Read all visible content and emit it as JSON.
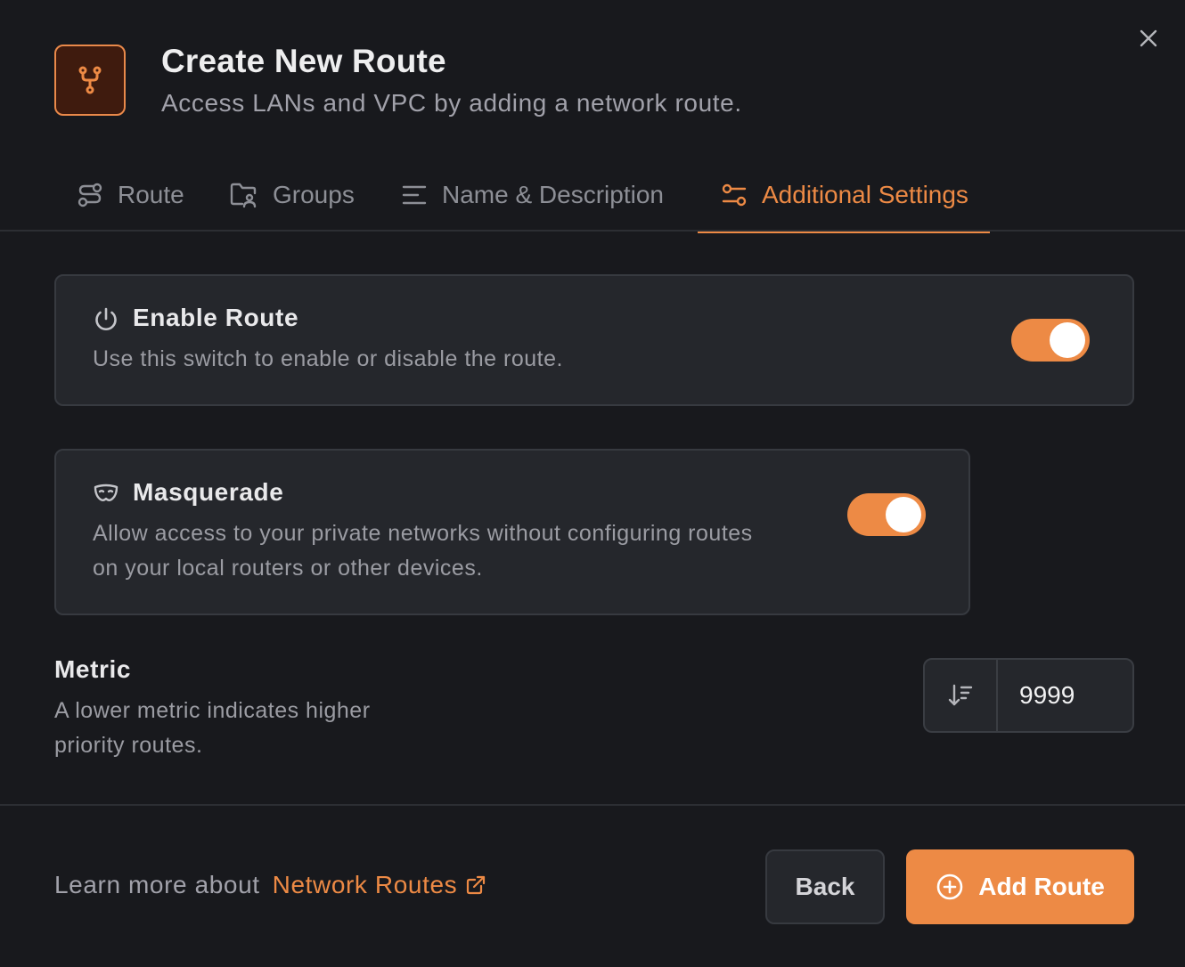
{
  "dialog": {
    "title": "Create New Route",
    "subtitle": "Access LANs and VPC by adding a network route.",
    "header_icon": "route-fork-icon",
    "close_icon": "close-icon"
  },
  "tabs": [
    {
      "label": "Route",
      "icon": "route-icon",
      "active": false
    },
    {
      "label": "Groups",
      "icon": "folder-groups-icon",
      "active": false
    },
    {
      "label": "Name & Description",
      "icon": "text-lines-icon",
      "active": false
    },
    {
      "label": "Additional Settings",
      "icon": "settings-sliders-icon",
      "active": true
    }
  ],
  "enable_route": {
    "title": "Enable Route",
    "description": "Use this switch to enable or disable the route.",
    "icon": "power-icon",
    "enabled": true
  },
  "masquerade": {
    "title": "Masquerade",
    "description": "Allow access to your private networks without configuring routes on your local routers or other devices.",
    "icon": "mask-icon",
    "enabled": true
  },
  "metric": {
    "title": "Metric",
    "description": "A lower metric indicates higher priority routes.",
    "value": "9999",
    "icon": "sort-descending-icon"
  },
  "footer": {
    "learn_prefix": "Learn more about",
    "learn_link": "Network Routes",
    "back_label": "Back",
    "add_label": "Add Route"
  },
  "colors": {
    "accent": "#ed8a45",
    "background": "#18191d",
    "card": "#25272c"
  }
}
